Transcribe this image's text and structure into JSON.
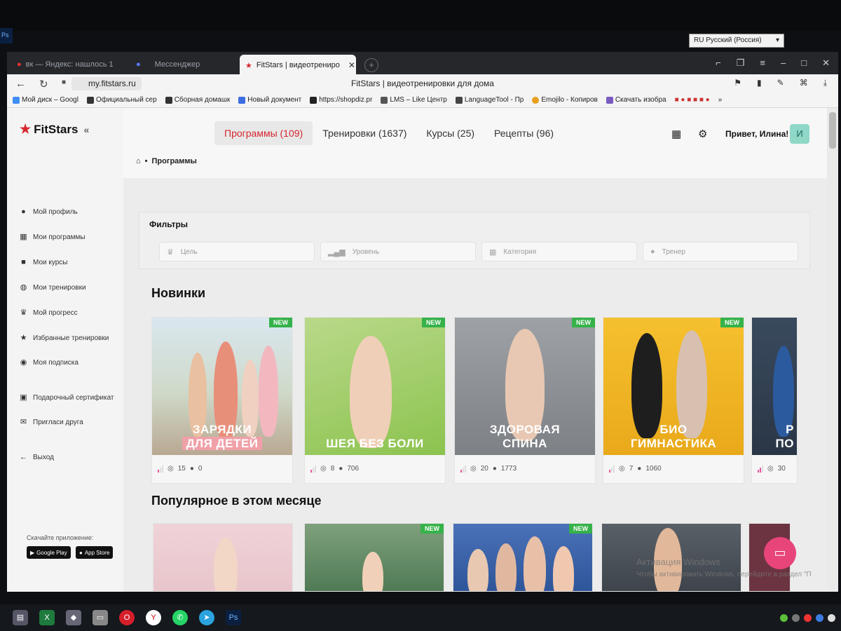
{
  "os": {
    "language_indicator": "RU Русский (Россия)",
    "side_badge": "Ps"
  },
  "browser": {
    "tabs": [
      {
        "label": "вк — Яндекс: нашлось 1"
      },
      {
        "label": "Мессенджер"
      },
      {
        "label": "FitStars | видеотрениро",
        "active": true
      }
    ],
    "url": "my.fitstars.ru",
    "page_title": "FitStars | видеотренировки для дома",
    "bookmarks": [
      "Мой диск – Googl",
      "Официальный сер",
      "Сборная домашк",
      "Новый документ",
      "https://shopdiz.pr",
      "LMS – Like Центр",
      "LanguageTool - Пр",
      "Emojilo - Копиров",
      "Скачать изобра"
    ]
  },
  "sidebar": {
    "logo": "FitStars",
    "items": [
      {
        "label": "Мой профиль",
        "icon": "user-icon"
      },
      {
        "label": "Мои программы",
        "icon": "grid-icon"
      },
      {
        "label": "Мои курсы",
        "icon": "folder-icon"
      },
      {
        "label": "Мои тренировки",
        "icon": "dumbbell-icon"
      },
      {
        "label": "Мой прогресс",
        "icon": "trophy-icon"
      },
      {
        "label": "Избранные тренировки",
        "icon": "star-icon"
      },
      {
        "label": "Моя подписка",
        "icon": "eye-icon"
      },
      {
        "label": "Подарочный сертификат",
        "icon": "gift-icon"
      },
      {
        "label": "Пригласи друга",
        "icon": "invite-icon"
      },
      {
        "label": "Выход",
        "icon": "logout-icon"
      }
    ],
    "app_caption": "Скачайте приложение:",
    "google_play": "Google Play",
    "app_store": "App Store"
  },
  "header": {
    "nav": [
      {
        "label": "Программы (109)",
        "active": true
      },
      {
        "label": "Тренировки (1637)"
      },
      {
        "label": "Курсы (25)"
      },
      {
        "label": "Рецепты (96)"
      }
    ],
    "greeting": "Привет, Илина!",
    "avatar_letter": "И"
  },
  "breadcrumb": {
    "separator": "•",
    "current": "Программы"
  },
  "filters": {
    "title": "Фильтры",
    "fields": [
      {
        "placeholder": "Цель",
        "icon": "trophy-icon"
      },
      {
        "placeholder": "Уровень",
        "icon": "bars-icon"
      },
      {
        "placeholder": "Категория",
        "icon": "grid-icon"
      },
      {
        "placeholder": "Тренер",
        "icon": "user-icon"
      }
    ]
  },
  "sections": {
    "new_title": "Новинки",
    "popular_title": "Популярное в этом месяце"
  },
  "cards": [
    {
      "title_line1": "ЗАРЯДКИ",
      "title_line2": "ДЛЯ ДЕТЕЙ",
      "badge": "NEW",
      "workouts": "15",
      "users": "0"
    },
    {
      "title_line1": "ШЕЯ БЕЗ БОЛИ",
      "title_line2": "",
      "badge": "NEW",
      "workouts": "8",
      "users": "706"
    },
    {
      "title_line1": "ЗДОРОВАЯ",
      "title_line2": "СПИНА",
      "badge": "NEW",
      "workouts": "20",
      "users": "1773"
    },
    {
      "title_line1": "БИО",
      "title_line2": "ГИМНАСТИКА",
      "badge": "NEW",
      "workouts": "7",
      "users": "1060"
    },
    {
      "title_line1": "Р",
      "title_line2": "ПО",
      "badge": "",
      "workouts": "30",
      "users": ""
    }
  ],
  "popular_cards": [
    {
      "badge": ""
    },
    {
      "badge": "NEW"
    },
    {
      "badge": "NEW"
    },
    {
      "badge": ""
    }
  ],
  "watermark": {
    "line1": "Активация Windows",
    "line2": "Чтобы активировать Windows, перейдите в раздел \"П"
  },
  "colors": {
    "accent": "#d6262e",
    "new_badge": "#36b24a",
    "chat": "#e8457a"
  }
}
